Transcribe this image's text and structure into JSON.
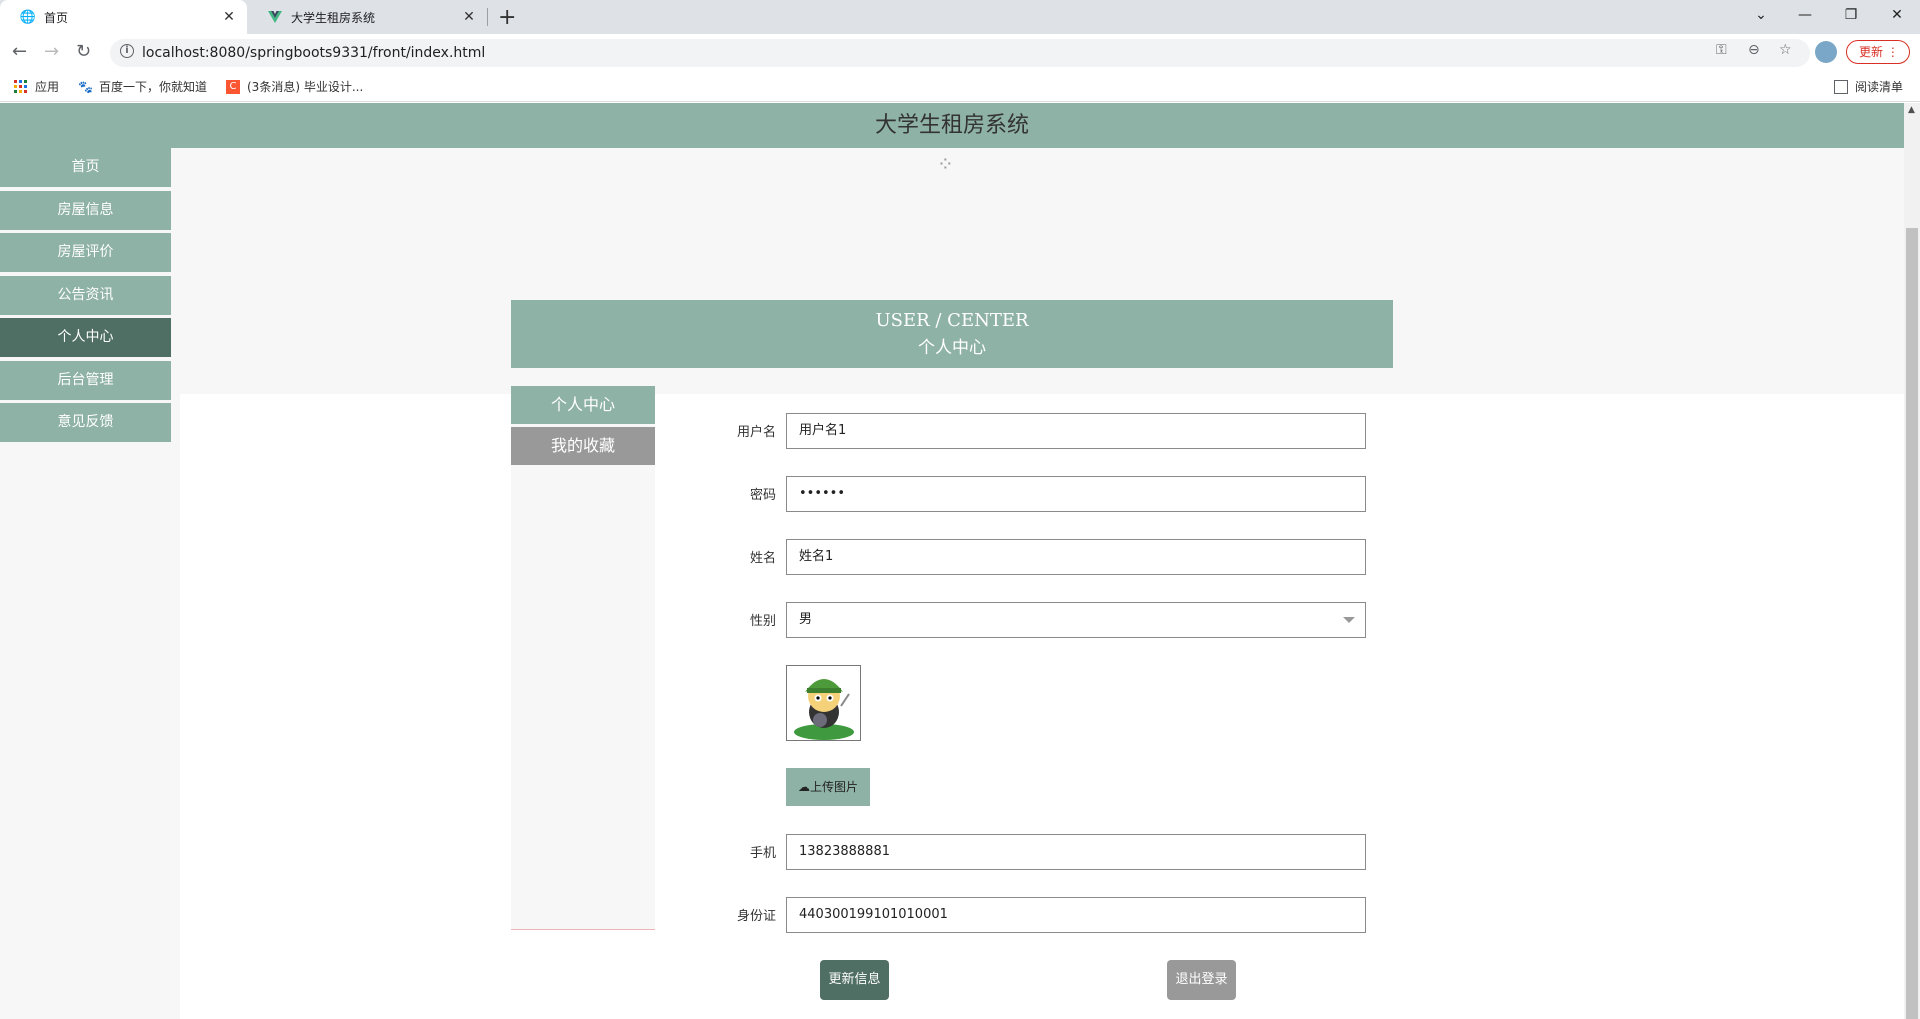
{
  "browser": {
    "tabs": [
      {
        "title": "首页",
        "icon": "globe-icon"
      },
      {
        "title": "大学生租房系统",
        "icon": "vue-icon"
      }
    ],
    "new_tab": "+",
    "url": "localhost:8080/springboots9331/front/index.html",
    "update_label": "更新",
    "bookmarks": [
      {
        "label": "应用",
        "icon": "apps-grid-icon"
      },
      {
        "label": "百度一下，你就知道",
        "icon": "baidu-paw-icon"
      },
      {
        "label": "(3条消息) 毕业设计...",
        "icon": "csdn-icon"
      }
    ],
    "reading_list": "阅读清单"
  },
  "site": {
    "title": "大学生租房系统",
    "nav": [
      {
        "label": "首页",
        "active": false
      },
      {
        "label": "房屋信息",
        "active": false
      },
      {
        "label": "房屋评价",
        "active": false
      },
      {
        "label": "公告资讯",
        "active": false
      },
      {
        "label": "个人中心",
        "active": true
      },
      {
        "label": "后台管理",
        "active": false
      },
      {
        "label": "意见反馈",
        "active": false
      }
    ]
  },
  "user_center": {
    "banner_en": "USER / CENTER",
    "banner_cn": "个人中心",
    "side": [
      {
        "label": "个人中心",
        "active": true
      },
      {
        "label": "我的收藏",
        "active": false
      }
    ],
    "form": {
      "username": {
        "label": "用户名",
        "value": "用户名1"
      },
      "password": {
        "label": "密码",
        "value": "••••••"
      },
      "name": {
        "label": "姓名",
        "value": "姓名1"
      },
      "gender": {
        "label": "性别",
        "value": "男"
      },
      "upload_label": "上传图片",
      "phone": {
        "label": "手机",
        "value": "13823888881"
      },
      "id_card": {
        "label": "身份证",
        "value": "440300199101010001"
      }
    },
    "update_button": "更新信息",
    "logout_button": "退出登录"
  },
  "colors": {
    "primary": "#8fb2a7",
    "primary_dark": "#4f6e64",
    "secondary": "#999999"
  }
}
